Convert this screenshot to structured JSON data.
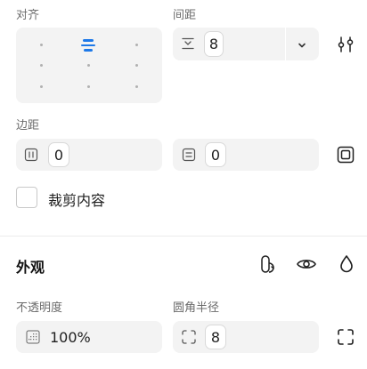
{
  "layout_section": {
    "align_label": "对齐",
    "spacing_label": "间距",
    "spacing_value": "8",
    "padding_label": "边距",
    "padding_horizontal_value": "0",
    "padding_vertical_value": "0",
    "clip_content_label": "裁剪内容",
    "clip_content_checked": false
  },
  "appearance_section": {
    "title": "外观",
    "opacity_label": "不透明度",
    "opacity_value": "100%",
    "corner_radius_label": "圆角半径",
    "corner_radius_value": "8"
  },
  "colors": {
    "accent": "#1e79e8",
    "field_bg": "#f3f3f3",
    "label_text": "#6b6b6b"
  },
  "icons": {
    "spacing": "vertical-spacing-icon",
    "spacing_dropdown": "chevron-down-icon",
    "layout_settings": "sliders-icon",
    "padding_horizontal": "padding-horizontal-icon",
    "padding_vertical": "padding-vertical-icon",
    "padding_individual": "individual-padding-icon",
    "blend": "blend-mode-icon",
    "visibility": "eye-icon",
    "fill": "droplet-icon",
    "opacity": "opacity-grid-icon",
    "corner": "corner-radius-icon",
    "independent_corners": "independent-corners-icon"
  }
}
